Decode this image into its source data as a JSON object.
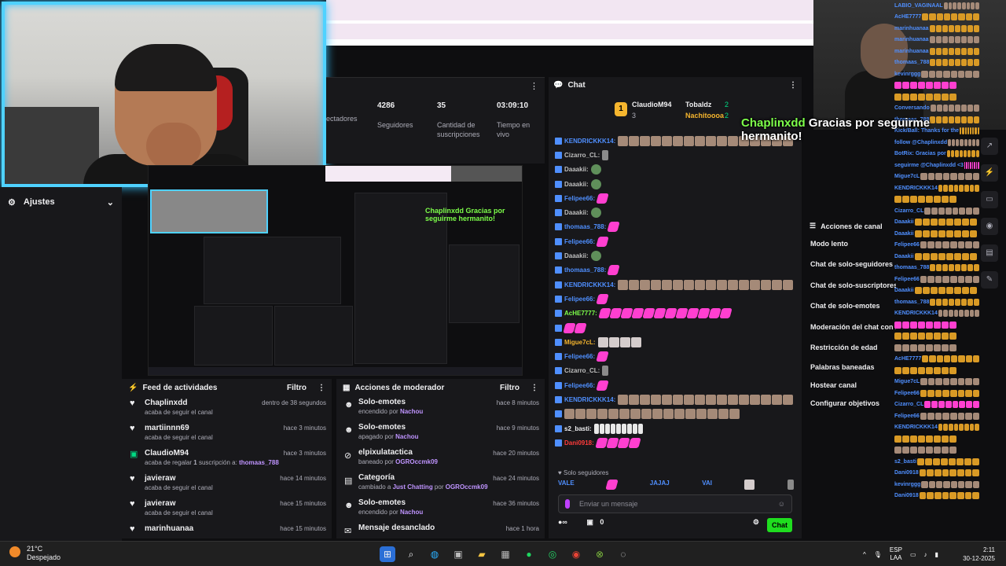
{
  "settings": {
    "label": "Ajustes"
  },
  "stats": {
    "partial_label": "ectadores",
    "followers": {
      "value": "4286",
      "label": "Seguidores"
    },
    "subs": {
      "value": "35",
      "label": "Cantidad de suscripciones"
    },
    "uptime": {
      "value": "03:09:10",
      "label": "Tiempo en vivo"
    }
  },
  "feed": {
    "title": "Feed de actividades",
    "filter": "Filtro",
    "items": [
      {
        "user": "Chaplinxdd",
        "desc": "acaba de seguir el canal",
        "time": "dentro de 38 segundos"
      },
      {
        "user": "martiinnn69",
        "desc": "acaba de seguir el canal",
        "time": "hace 3 minutos"
      },
      {
        "user": "ClaudioM94",
        "desc_pre": "acaba de regalar ",
        "desc_num": "1",
        "desc_mid": " suscripción a: ",
        "desc_hl": "thomaas_788",
        "time": "hace 3 minutos"
      },
      {
        "user": "javieraw",
        "desc": "acaba de seguir el canal",
        "time": "hace 14 minutos"
      },
      {
        "user": "javieraw",
        "desc": "acaba de seguir el canal",
        "time": "hace 15 minutos"
      },
      {
        "user": "marinhuanaa",
        "desc": "",
        "time": "hace 15 minutos"
      }
    ]
  },
  "mod": {
    "title": "Acciones de moderador",
    "filter": "Filtro",
    "items": [
      {
        "title": "Solo-emotes",
        "pre": "encendido por ",
        "hl": "Nachou",
        "time": "hace 8 minutos"
      },
      {
        "title": "Solo-emotes",
        "pre": "apagado por ",
        "hl": "Nachou",
        "time": "hace 9 minutos"
      },
      {
        "title": "elpixulatactica",
        "pre": "baneado por ",
        "hl": "OGROccmk09",
        "time": "hace 20 minutos"
      },
      {
        "title": "Categoría",
        "pre": "cambiado a ",
        "hl": "Just Chatting",
        "mid": " por ",
        "hl2": "OGROccmk09",
        "time": "hace 24 minutos"
      },
      {
        "title": "Solo-emotes",
        "pre": "encendido por ",
        "hl": "Nachou",
        "time": "hace 36 minutos"
      },
      {
        "title": "Mensaje desanclado",
        "pre": "",
        "hl": "",
        "time": "hace 1 hora"
      }
    ]
  },
  "chat": {
    "title": "Chat",
    "leaderboard": {
      "first": {
        "rank": "1",
        "name": "ClaudioM94",
        "count": "3"
      },
      "second": {
        "name": "Tobaldz",
        "count": "2"
      },
      "third": {
        "name": "Nachitoooa",
        "count": "2"
      }
    },
    "messages": [
      {
        "user": "KENDRICKKK14:",
        "color": "#4f8fff",
        "emotes": "m",
        "count": 16
      },
      {
        "user": "Cizarro_CL:",
        "color": "#bfbfbf",
        "emotes": "k",
        "count": 1
      },
      {
        "user": "Daaakii:",
        "color": "#bfbfbf",
        "emotes": "f",
        "count": 1
      },
      {
        "user": "Daaakii:",
        "color": "#bfbfbf",
        "emotes": "f",
        "count": 1
      },
      {
        "user": "Felipee66:",
        "color": "#4f8fff",
        "emotes": "p",
        "count": 1
      },
      {
        "user": "Daaakii:",
        "color": "#bfbfbf",
        "emotes": "f",
        "count": 1
      },
      {
        "user": "thomaas_788:",
        "color": "#4f8fff",
        "emotes": "p",
        "count": 1
      },
      {
        "user": "Felipee66:",
        "color": "#4f8fff",
        "emotes": "p",
        "count": 1
      },
      {
        "user": "Daaakii:",
        "color": "#bfbfbf",
        "emotes": "f",
        "count": 1
      },
      {
        "user": "thomaas_788:",
        "color": "#4f8fff",
        "emotes": "p",
        "count": 1
      },
      {
        "user": "KENDRICKKK14:",
        "color": "#4f8fff",
        "emotes": "m",
        "count": 16
      },
      {
        "user": "Felipee66:",
        "color": "#4f8fff",
        "emotes": "p",
        "count": 1
      },
      {
        "user": "AcHE7777:",
        "color": "#7dff4a",
        "emotes": "p",
        "count": 12
      },
      {
        "user": "",
        "color": "#4f8fff",
        "emotes": "p",
        "count": 2
      },
      {
        "user": "Migue7cL:",
        "color": "#f5b52e",
        "emotes": "g",
        "count": 4
      },
      {
        "user": "Felipee66:",
        "color": "#4f8fff",
        "emotes": "p",
        "count": 1
      },
      {
        "user": "Cizarro_CL:",
        "color": "#bfbfbf",
        "emotes": "k",
        "count": 1
      },
      {
        "user": "Felipee66:",
        "color": "#4f8fff",
        "emotes": "p",
        "count": 1
      },
      {
        "user": "KENDRICKKK14:",
        "color": "#4f8fff",
        "emotes": "m",
        "count": 16
      },
      {
        "user": "",
        "color": "#4f8fff",
        "emotes": "m",
        "count": 16
      },
      {
        "user": "s2_basti:",
        "color": "#efeff1",
        "emotes": "w",
        "count": 9
      },
      {
        "user": "Dani0918:",
        "color": "#ff3b3b",
        "emotes": "p",
        "count": 4
      }
    ],
    "follow_only": "Solo seguidores",
    "emote_bar": [
      "VALE",
      "JAJAJ",
      "VAI"
    ],
    "input_placeholder": "Enviar un mensaje",
    "points": "0",
    "button": "Chat"
  },
  "actions": {
    "title": "Acciones de canal",
    "items": [
      "Modo lento",
      "Chat de solo-seguidores",
      "Chat de solo-suscriptores",
      "Chat de solo-emotes",
      "Moderación del chat con IA",
      "Restricción de edad",
      "Palabras baneadas",
      "Hostear canal",
      "Configurar objetivos"
    ]
  },
  "overlay": {
    "user": "Chaplinxdd",
    "text": " Gracias por seguirme hermanito!"
  },
  "preview_text": "Chaplinxdd Gracias por seguirme hermanito!",
  "right_chat": [
    "LABIO_VAGINAAL",
    "AcHE7777",
    "marinhuanaa",
    "marinhuanaa",
    "marinhuanaa",
    "thomaas_788",
    "kevinrggg",
    "",
    "",
    "Conversando",
    "thomaas_788",
    "Kick/Ball: Thanks for the",
    "follow @Chaplinxdd",
    "BotRix: Gracias por",
    "seguirme @Chaplinxdd <3",
    "Migue7cL",
    "KENDRICKKK14",
    "",
    "Cizarro_CL",
    "Daaakii",
    "Daaakii",
    "Felipee66",
    "Daaakii",
    "thomaas_788",
    "Felipee66",
    "Daaakii",
    "thomaas_788",
    "KENDRICKKK14",
    "",
    "",
    "",
    "AcHE7777",
    "",
    "Migue7cL",
    "Felipee66",
    "Cizarro_CL",
    "Felipee66",
    "KENDRICKKK14",
    "",
    "",
    "s2_basti",
    "Dani0918",
    "kevinrggg",
    "Dani0918"
  ],
  "taskbar": {
    "temp": "21°C",
    "condition": "Despejado",
    "lang1": "ESP",
    "lang2": "LAA",
    "time": "2:11",
    "date": "30-12-2025"
  }
}
